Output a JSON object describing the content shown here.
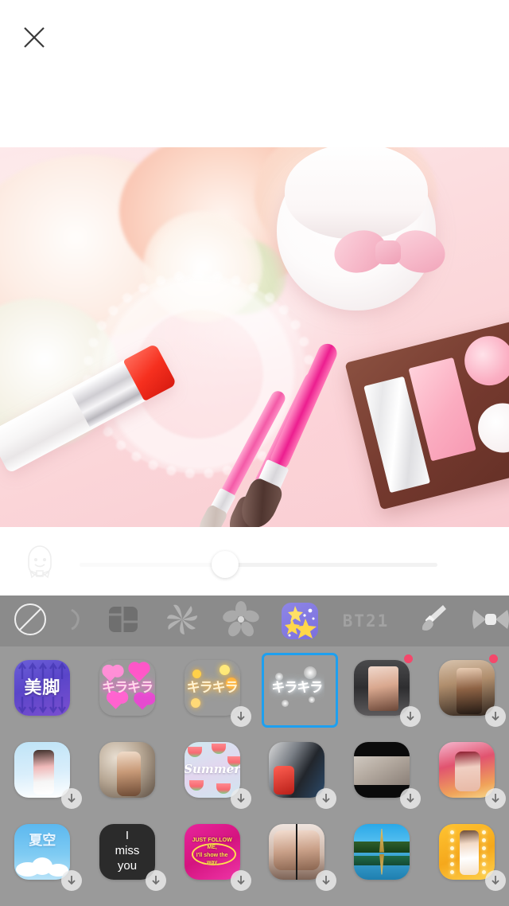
{
  "topbar": {
    "close_icon": "close-icon"
  },
  "photo": {
    "description": "flat-lay of cosmetics on pink background",
    "objects": [
      "peach-flowers",
      "powder-compact-with-bow",
      "lace-doily",
      "lipstick",
      "makeup-brushes",
      "eyeshadow-palette"
    ]
  },
  "slider": {
    "icon": "face-smiley-icon",
    "value": 40,
    "min": 0,
    "max": 100
  },
  "categories": [
    {
      "name": "none",
      "icon": "no-filter-icon",
      "label": "",
      "selected": false
    },
    {
      "name": "partial",
      "icon": "partial-icon",
      "label": "",
      "selected": false
    },
    {
      "name": "collage",
      "icon": "collage-grid-icon",
      "label": "",
      "selected": false
    },
    {
      "name": "pinwheel",
      "icon": "pinwheel-icon",
      "label": "",
      "selected": false
    },
    {
      "name": "flower",
      "icon": "flower-icon",
      "label": "",
      "selected": false
    },
    {
      "name": "sparkle",
      "icon": "star-sparkle-icon",
      "label": "",
      "selected": true
    },
    {
      "name": "bt21",
      "icon": "text-icon",
      "label": "BT21",
      "selected": false
    },
    {
      "name": "brush",
      "icon": "paintbrush-icon",
      "label": "",
      "selected": false
    },
    {
      "name": "ribbon",
      "icon": "bow-ribbon-icon",
      "label": "",
      "selected": false
    }
  ],
  "accent_colors": {
    "selection_blue": "#1ea0f0",
    "badge_red": "#f4486b",
    "toolbar_gray": "#8b8b8b",
    "grid_gray": "#9a9a9a"
  },
  "stickers": [
    {
      "id": "bikyaku",
      "label": "美脚",
      "style": "t-bikyaku",
      "download": false,
      "badge": false,
      "selected": false
    },
    {
      "id": "kira-pink",
      "label": "キラキラ",
      "style": "t-kira-pink",
      "download": false,
      "badge": false,
      "selected": false
    },
    {
      "id": "kira-orange",
      "label": "キラキラ",
      "style": "t-kira-orange",
      "download": true,
      "badge": false,
      "selected": false
    },
    {
      "id": "kira-white",
      "label": "キラキラ",
      "style": "t-kira-white",
      "download": false,
      "badge": false,
      "selected": true
    },
    {
      "id": "photo-1",
      "label": "",
      "style": "t-photo1",
      "download": true,
      "badge": true,
      "selected": false
    },
    {
      "id": "photo-2",
      "label": "",
      "style": "t-photo2",
      "download": true,
      "badge": true,
      "selected": false
    },
    {
      "id": "girl-blue",
      "label": "",
      "style": "t-girlblue",
      "download": true,
      "badge": false,
      "selected": false
    },
    {
      "id": "bokeh",
      "label": "",
      "style": "t-bokeh",
      "download": false,
      "badge": false,
      "selected": false
    },
    {
      "id": "summer",
      "label": "Summer",
      "style": "t-summer",
      "download": true,
      "badge": false,
      "selected": false
    },
    {
      "id": "drops",
      "label": "",
      "style": "t-drops",
      "download": true,
      "badge": false,
      "selected": false
    },
    {
      "id": "letterbox",
      "label": "",
      "style": "t-letterbox",
      "download": true,
      "badge": false,
      "selected": false
    },
    {
      "id": "red-hair",
      "label": "",
      "style": "t-redhair",
      "download": true,
      "badge": false,
      "selected": false
    },
    {
      "id": "natsuzora",
      "label": "夏空",
      "style": "t-natsuzora",
      "download": true,
      "badge": false,
      "selected": false
    },
    {
      "id": "miss-you",
      "label": "I\nmiss\nyou",
      "style": "t-missyou",
      "download": true,
      "badge": false,
      "selected": false
    },
    {
      "id": "follow-me",
      "label": "JUST FOLLOW ME,\nI'll show the way",
      "style": "t-follow",
      "download": true,
      "badge": false,
      "selected": false
    },
    {
      "id": "mirror",
      "label": "",
      "style": "t-mirror",
      "download": true,
      "badge": false,
      "selected": false
    },
    {
      "id": "eiffel",
      "label": "",
      "style": "t-eiffel",
      "download": false,
      "badge": false,
      "selected": false
    },
    {
      "id": "gold",
      "label": "",
      "style": "t-gold",
      "download": true,
      "badge": false,
      "selected": false
    }
  ]
}
